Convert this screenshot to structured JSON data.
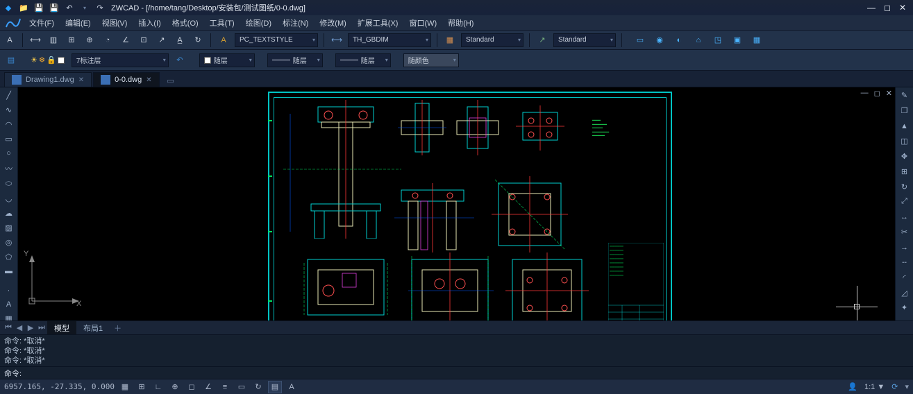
{
  "title": {
    "app": "ZWCAD",
    "path": "[/home/tang/Desktop/安装包/测试图纸/0-0.dwg]"
  },
  "menus": [
    "文件(F)",
    "编辑(E)",
    "视图(V)",
    "插入(I)",
    "格式(O)",
    "工具(T)",
    "绘图(D)",
    "标注(N)",
    "修改(M)",
    "扩展工具(X)",
    "窗口(W)",
    "帮助(H)"
  ],
  "styles": {
    "textstyle": "PC_TEXTSTYLE",
    "dimstyle": "TH_GBDIM",
    "tablestyle": "Standard",
    "mleaderstyle": "Standard"
  },
  "layers": {
    "current": "7标注层",
    "linetype_label1": "随层",
    "linetype_label2": "随层",
    "lineweight_label": "随层",
    "color_label": "随颜色"
  },
  "tabs": [
    {
      "name": "Drawing1.dwg",
      "active": false
    },
    {
      "name": "0-0.dwg",
      "active": true
    }
  ],
  "layout_tabs": {
    "model": "模型",
    "layout1": "布局1"
  },
  "command": {
    "hist": [
      "命令: *取消*",
      "命令: *取消*",
      "命令: *取消*"
    ],
    "prompt": "命令:"
  },
  "status": {
    "coords": "6957.165, -27.335, 0.000",
    "scale": "1:1",
    "anno_lock": "▼"
  },
  "axes": {
    "x": "X",
    "y": "Y"
  }
}
